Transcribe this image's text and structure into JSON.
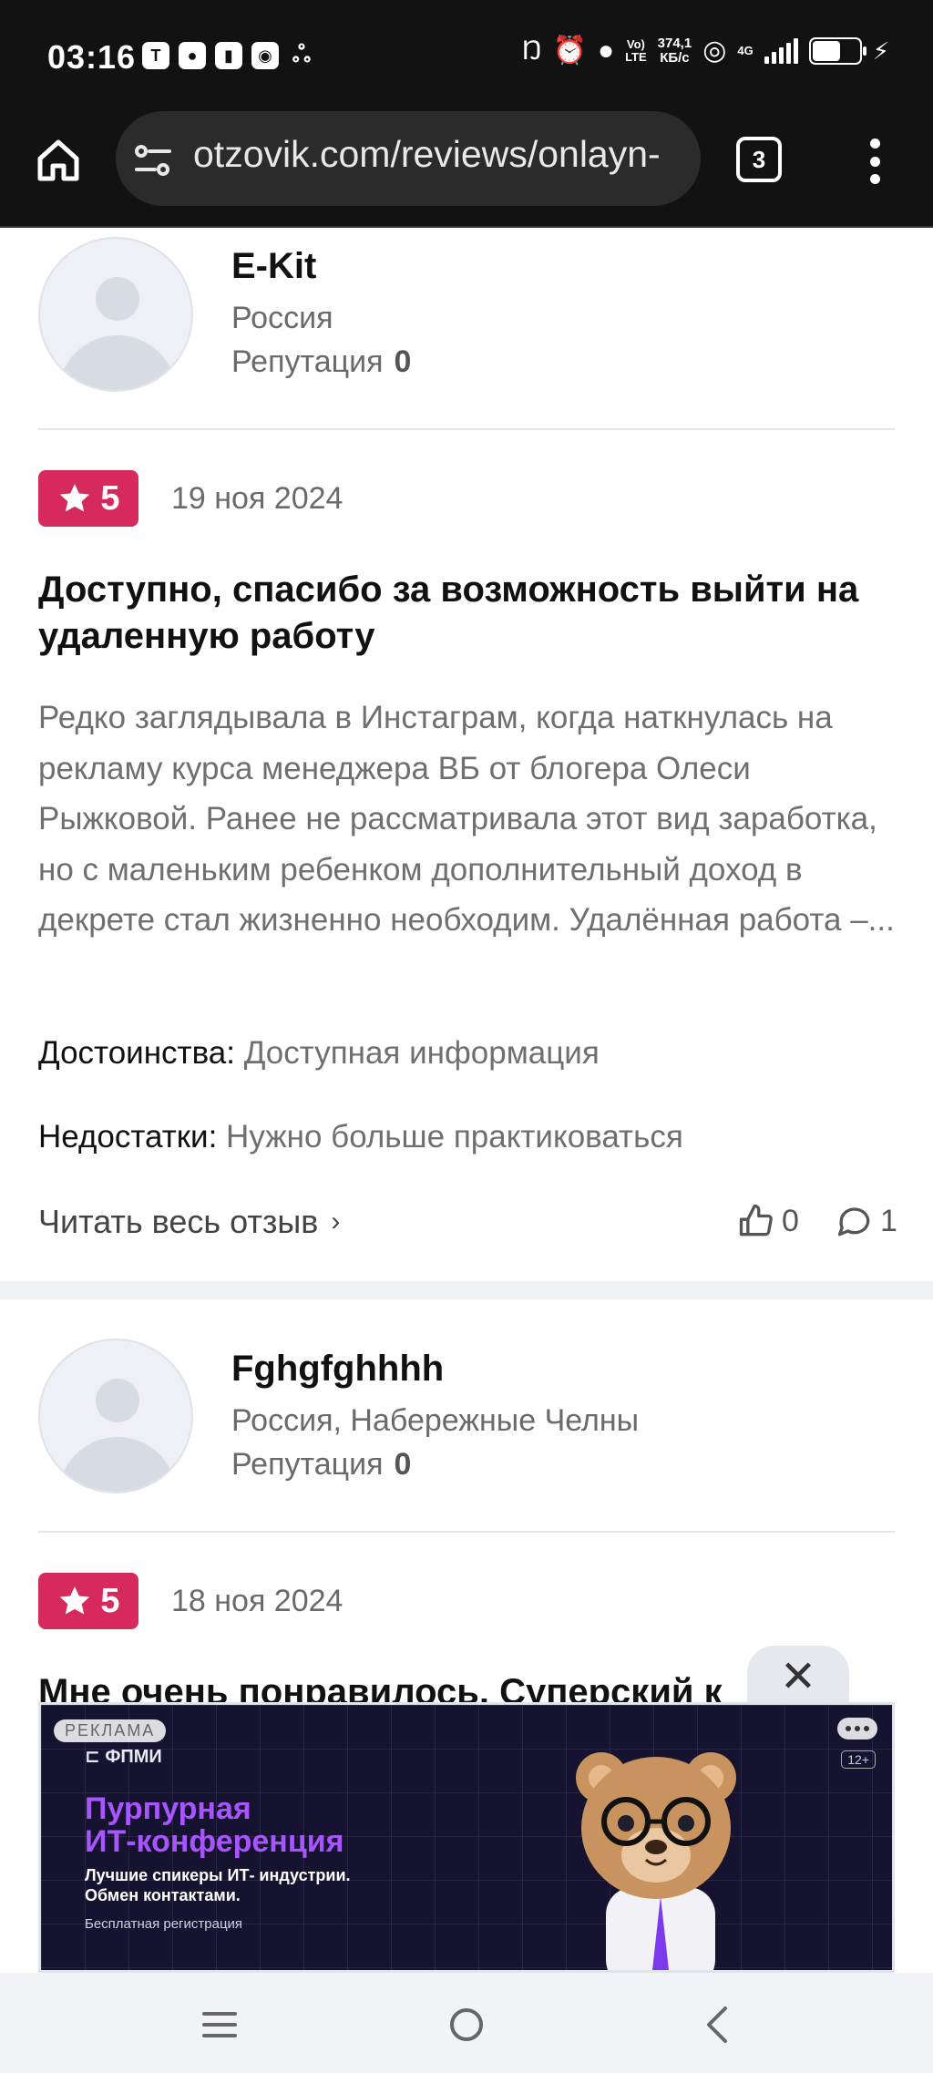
{
  "status_bar": {
    "time": "03:16",
    "network_speed_value": "374,1",
    "network_speed_unit": "КБ/с",
    "volte_top": "Vo)",
    "volte_bottom": "LTE",
    "network_type": "4G",
    "icons": [
      "telegram-icon",
      "location-icon",
      "app-icon",
      "nfc-sound-icon",
      "game-icon",
      "nfc-icon",
      "alarm-icon",
      "location-icon",
      "hotspot-icon",
      "signal-icon",
      "battery-icon",
      "charging-icon"
    ]
  },
  "browser": {
    "url": "otzovik.com/reviews/onlayn-",
    "tab_count": "3"
  },
  "review1": {
    "user_name": "E-Kit",
    "user_location": "Россия",
    "reputation_label": "Репутация",
    "reputation_value": "0",
    "rating": "5",
    "date": "19 ноя 2024",
    "title": "Доступно, спасибо за возможность выйти на удаленную работу",
    "body": "Редко заглядывала в Инстаграм, когда наткнулась на рекламу курса менеджера ВБ от блогера Олеси Рыжковой. Ранее не рассматривала этот вид заработка, но с маленьким ребенком дополнительный доход в декрете стал жизненно необходим. Удалённая работа –...",
    "pros_label": "Достоинства:",
    "pros_value": "Доступная информация",
    "cons_label": "Недостатки:",
    "cons_value": "Нужно больше практиковаться",
    "read_more": "Читать весь отзыв",
    "likes": "0",
    "comments": "1"
  },
  "review2": {
    "user_name": "Fghgfghhhh",
    "user_location": "Россия, Набережные Челны",
    "reputation_label": "Репутация",
    "reputation_value": "0",
    "rating": "5",
    "date": "18 ноя 2024",
    "title": "Мне очень понравилось. Суперский к"
  },
  "ad": {
    "label": "РЕКЛАМА",
    "age_rating": "12+",
    "brand": "ФПМИ",
    "title_line1": "Пурпурная",
    "title_line2": "ИТ-конференция",
    "subtitle_line1": "Лучшие спикеры ИТ- индустрии.",
    "subtitle_line2": "Обмен контактами.",
    "registration": "Бесплатная регистрация"
  },
  "colors": {
    "rating_badge": "#d62a5c",
    "ad_title": "#a855ff"
  }
}
